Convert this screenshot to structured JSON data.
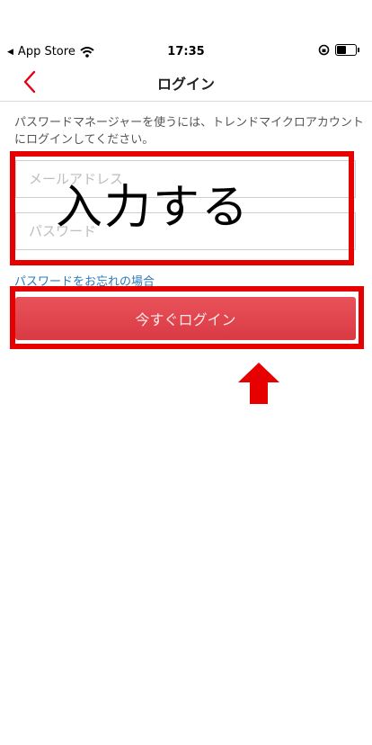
{
  "status_bar": {
    "back_app_label": "App Store",
    "time": "17:35"
  },
  "nav": {
    "title": "ログイン",
    "back_icon": "chevron-left-icon",
    "accent_color": "#e60012"
  },
  "form": {
    "description": "パスワードマネージャーを使うには、トレンドマイクロアカウントにログインしてください。",
    "email_placeholder": "メールアドレス",
    "password_placeholder": "パスワード",
    "forgot_label": "パスワードをお忘れの場合",
    "login_label": "今すぐログイン"
  },
  "annotations": {
    "overlay_text": "入力する",
    "highlight_color": "#e60000",
    "arrow_icon": "up-arrow-icon"
  }
}
